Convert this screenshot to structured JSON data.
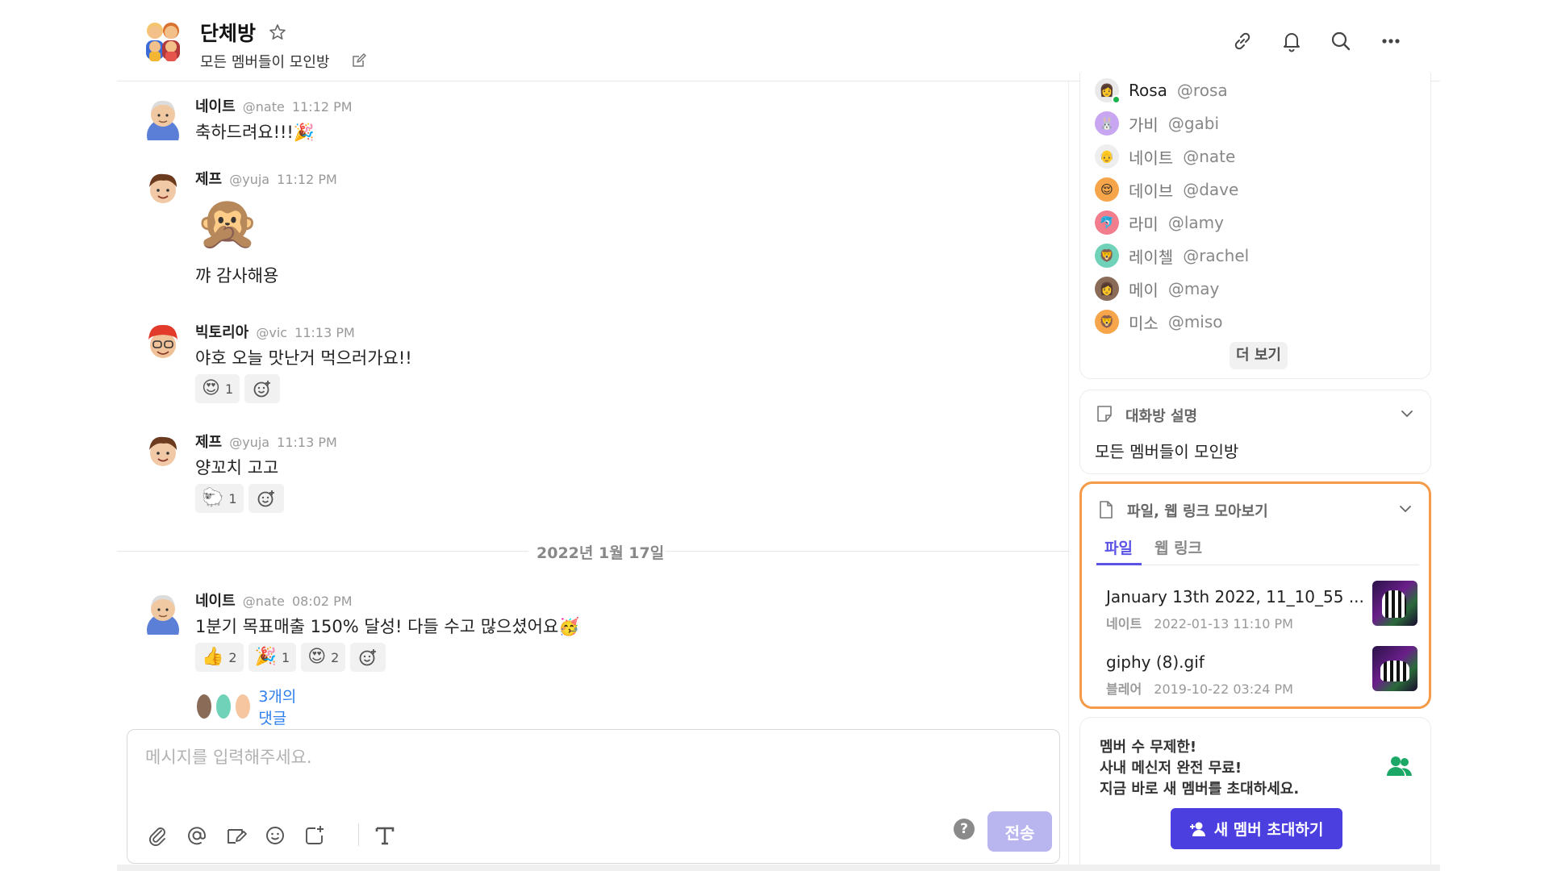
{
  "header": {
    "room_title": "단체방",
    "room_subtitle": "모든 멤버들이 모인방"
  },
  "messages": [
    {
      "name": "네이트",
      "handle": "@nate",
      "time": "11:12 PM",
      "text": "축하드려요!!!🎉"
    },
    {
      "name": "제프",
      "handle": "@yuja",
      "time": "11:12 PM",
      "sticker": "🙊",
      "text": "꺄 감사해용"
    },
    {
      "name": "빅토리아",
      "handle": "@vic",
      "time": "11:13 PM",
      "text": "야호 오늘 맛난거 먹으러가요!!",
      "reactions": [
        {
          "emoji": "😍",
          "count": "1"
        }
      ]
    },
    {
      "name": "제프",
      "handle": "@yuja",
      "time": "11:13 PM",
      "text": "양꼬치 고고",
      "reactions": [
        {
          "emoji": "🐑",
          "count": "1"
        }
      ]
    },
    {
      "name": "네이트",
      "handle": "@nate",
      "time": "08:02 PM",
      "text": "1분기 목표매출 150% 달성! 다들 수고 많으셨어요🥳",
      "reactions": [
        {
          "emoji": "👍",
          "count": "2"
        },
        {
          "emoji": "🎉",
          "count": "1"
        },
        {
          "emoji": "😍",
          "count": "2"
        }
      ],
      "thread_label": "3개의 댓글"
    }
  ],
  "date_divider": "2022년 1월 17일",
  "composer": {
    "placeholder": "메시지를 입력해주세요.",
    "send_label": "전송",
    "help_label": "?"
  },
  "members": {
    "items": [
      {
        "name": "Rosa",
        "handle": "@rosa",
        "color": "#e9e9e9",
        "emoji": "👩"
      },
      {
        "name": "가비",
        "handle": "@gabi",
        "color": "#c9a6f2",
        "emoji": "🐰"
      },
      {
        "name": "네이트",
        "handle": "@nate",
        "color": "#eeeeee",
        "emoji": "👴"
      },
      {
        "name": "데이브",
        "handle": "@dave",
        "color": "#f7a54a",
        "emoji": "😌"
      },
      {
        "name": "라미",
        "handle": "@lamy",
        "color": "#f27d8c",
        "emoji": "🐬"
      },
      {
        "name": "레이첼",
        "handle": "@rachel",
        "color": "#6fd2b9",
        "emoji": "🦁"
      },
      {
        "name": "메이",
        "handle": "@may",
        "color": "#8a6b58",
        "emoji": "👩"
      },
      {
        "name": "미소",
        "handle": "@miso",
        "color": "#f7a54a",
        "emoji": "🦁"
      }
    ],
    "more_label": "더 보기"
  },
  "description": {
    "title": "대화방 설명",
    "text": "모든 멤버들이 모인방"
  },
  "files": {
    "title": "파일, 웹 링크 모아보기",
    "tabs": [
      "파일",
      "웹 링크"
    ],
    "items": [
      {
        "name": "January 13th 2022, 11_10_55 ...",
        "author": "네이트",
        "date": "2022-01-13 11:10 PM"
      },
      {
        "name": "giphy (8).gif",
        "author": "블레어",
        "date": "2019-10-22 03:24 PM"
      }
    ]
  },
  "invite": {
    "line1": "멤버 수 무제한!",
    "line2": "사내 메신저 완전 무료!",
    "line3": "지금 바로 새 멤버를 초대하세요.",
    "button": "새 멤버 초대하기",
    "accent": "#4b3fe0"
  },
  "colors": {
    "accent": "#5b53e6",
    "highlight_border": "#f59a48",
    "link": "#2f80ed",
    "send_disabled": "#b8b5ef"
  }
}
